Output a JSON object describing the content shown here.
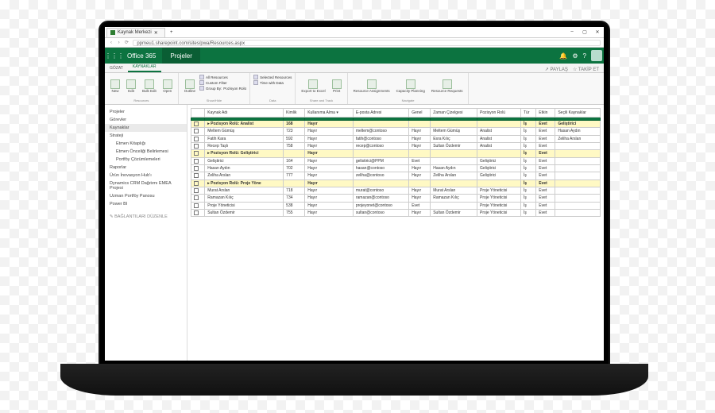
{
  "browser": {
    "tab_title": "Kaynak Merkezi",
    "new_tab": "+",
    "win_min": "–",
    "win_max": "▢",
    "win_close": "✕",
    "nav_back": "‹",
    "nav_fwd": "›",
    "nav_reload": "⟳",
    "url": "ppmeu1.sharepoint.com/sites/pwa/Resources.aspx"
  },
  "suite": {
    "waffle": "⋮⋮⋮",
    "brand": "Office 365",
    "app": "Projeler",
    "bell": "🔔",
    "gear": "⚙",
    "help": "?"
  },
  "ribbon": {
    "tabs": [
      "GÖZAT",
      "KAYNAKLAR"
    ],
    "share": {
      "paylas": "↗ PAYLAŞ",
      "takipet": "☆ TAKİP ET"
    },
    "groups": {
      "resources": {
        "label": "Resources",
        "new": "New",
        "edit": "Edit",
        "bulk": "Bulk Edit",
        "open": "Open"
      },
      "show": {
        "label": "Show/Hide",
        "outline": "Outline",
        "all": "All Resources",
        "custom": "Custom Filter",
        "groupby": "Group By:",
        "role": "Pozisyon Rolü"
      },
      "data": {
        "label": "Data",
        "selected": "Selected Resources",
        "timedata": "Time with Data"
      },
      "sharetrack": {
        "label": "Share and Track",
        "export": "Export to Excel",
        "print": "Print"
      },
      "navigate": {
        "label": "Navigate",
        "assign": "Resource Assignments",
        "capacity": "Capacity Planning",
        "requests": "Resource Requests"
      }
    }
  },
  "sidebar": {
    "items": [
      {
        "label": "Projeler",
        "indent": false,
        "active": false
      },
      {
        "label": "Görevler",
        "indent": false,
        "active": false
      },
      {
        "label": "Kaynaklar",
        "indent": false,
        "active": true
      },
      {
        "label": "Strateji",
        "indent": false,
        "active": false
      },
      {
        "label": "Etmen Kitaplığı",
        "indent": true,
        "active": false
      },
      {
        "label": "Etmen Önceliği Belirlemesi",
        "indent": true,
        "active": false
      },
      {
        "label": "Portföy Çözümlemeleri",
        "indent": true,
        "active": false
      },
      {
        "label": "Raporlar",
        "indent": false,
        "active": false
      },
      {
        "label": "Ürün İnovasyon Hub'ı",
        "indent": false,
        "active": false
      },
      {
        "label": "Dynamics CRM Dağıtımı EMEA Projesi",
        "indent": false,
        "active": false
      },
      {
        "label": "Uzman Portföy Panosu",
        "indent": false,
        "active": false
      },
      {
        "label": "Power BI",
        "indent": false,
        "active": false
      }
    ],
    "edit": "✎ BAĞLANTILARI DÜZENLE"
  },
  "grid": {
    "cols": [
      "",
      "Kaynak Adı",
      "Kimlik",
      "Kullanıma Alma ▾",
      "E-posta Adresi",
      "Genel",
      "Zaman Çizelgesi",
      "Pozisyon Rolü",
      "Tür",
      "Etkin",
      "Seçili Kaynaklar"
    ],
    "groups": [
      {
        "title": "▸ Pozisyon Rolü: Analist",
        "use": "168",
        "alma": "Hayır",
        "tur": "İş",
        "etkin": "Evet",
        "sel": "Geliştirici",
        "rows": [
          {
            "name": "Meltem Gümüş",
            "id": "723",
            "alma": "Hayır",
            "email": "meltem@contoso",
            "genel": "Hayır",
            "tc": "Meltem Gümüş",
            "role": "Analist",
            "tur": "İş",
            "etkin": "Evet",
            "sel": "Hasan Aydın"
          },
          {
            "name": "Fatih Kara",
            "id": "592",
            "alma": "Hayır",
            "email": "fatih@contoso",
            "genel": "Hayır",
            "tc": "Esra Kılıç",
            "role": "Analist",
            "tur": "İş",
            "etkin": "Evet",
            "sel": "Zeliha Arslan"
          },
          {
            "name": "Recep Taşlı",
            "id": "758",
            "alma": "Hayır",
            "email": "recep@contoso",
            "genel": "Hayır",
            "tc": "Sultan Özdemir",
            "role": "Analist",
            "tur": "İş",
            "etkin": "Evet",
            "sel": ""
          }
        ]
      },
      {
        "title": "▸ Pozisyon Rolü: Geliştirici",
        "use": "",
        "alma": "Hayır",
        "tur": "İş",
        "etkin": "Evet",
        "sel": "",
        "rows": [
          {
            "name": "Geliştirici",
            "id": "164",
            "alma": "Hayır",
            "email": "gelistirici@PPM",
            "genel": "Evet",
            "tc": "",
            "role": "Geliştirici",
            "tur": "İş",
            "etkin": "Evet",
            "sel": ""
          },
          {
            "name": "Hasan Aydın",
            "id": "702",
            "alma": "Hayır",
            "email": "hasan@contoso",
            "genel": "Hayır",
            "tc": "Hasan Aydın",
            "role": "Geliştirici",
            "tur": "İş",
            "etkin": "Evet",
            "sel": ""
          },
          {
            "name": "Zeliha Arslan",
            "id": "777",
            "alma": "Hayır",
            "email": "zeliha@contoso",
            "genel": "Hayır",
            "tc": "Zeliha Arslan",
            "role": "Geliştirici",
            "tur": "İş",
            "etkin": "Evet",
            "sel": ""
          }
        ]
      },
      {
        "title": "▸ Pozisyon Rolü: Proje Yöne",
        "use": "",
        "alma": "Hayır",
        "tur": "İş",
        "etkin": "Evet",
        "sel": "",
        "rows": [
          {
            "name": "Murat Arslan",
            "id": "718",
            "alma": "Hayır",
            "email": "murat@contoso",
            "genel": "Hayır",
            "tc": "Murat Arslan",
            "role": "Proje Yöneticisi",
            "tur": "İş",
            "etkin": "Evet",
            "sel": ""
          },
          {
            "name": "Ramazan Kılıç",
            "id": "734",
            "alma": "Hayır",
            "email": "ramazan@contoso",
            "genel": "Hayır",
            "tc": "Ramazan Kılıç",
            "role": "Proje Yöneticisi",
            "tur": "İş",
            "etkin": "Evet",
            "sel": ""
          },
          {
            "name": "Proje Yöneticisi",
            "id": "538",
            "alma": "Hayır",
            "email": "projeyonet@contoso",
            "genel": "Evet",
            "tc": "",
            "role": "Proje Yöneticisi",
            "tur": "İş",
            "etkin": "Evet",
            "sel": ""
          },
          {
            "name": "Sultan Özdemir",
            "id": "755",
            "alma": "Hayır",
            "email": "sultan@contoso",
            "genel": "Hayır",
            "tc": "Sultan Özdemir",
            "role": "Proje Yöneticisi",
            "tur": "İş",
            "etkin": "Evet",
            "sel": ""
          }
        ]
      }
    ]
  }
}
